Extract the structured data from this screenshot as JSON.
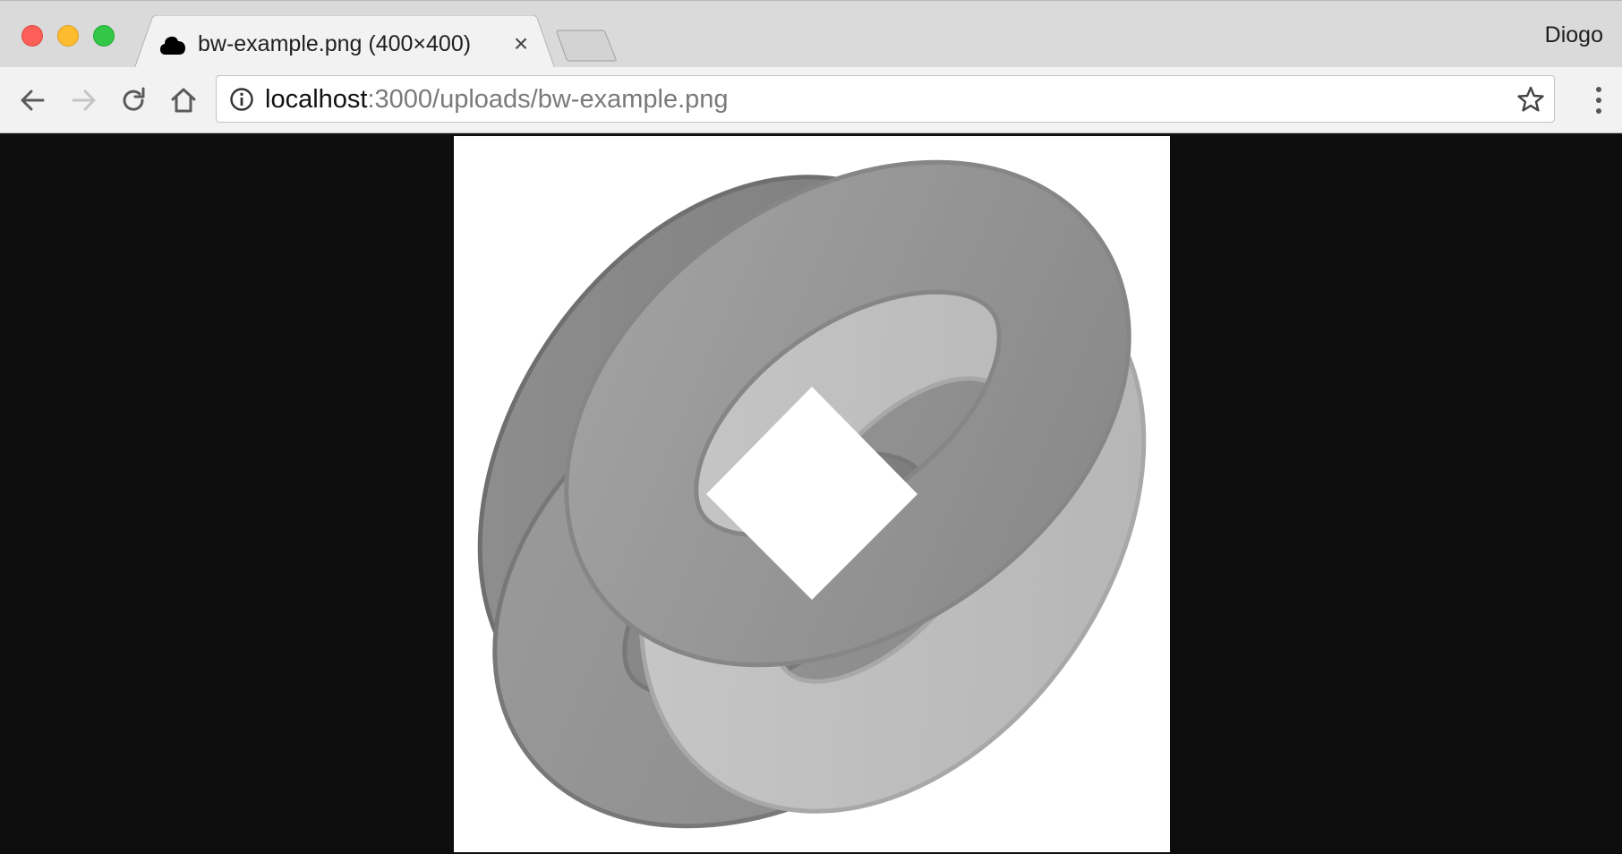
{
  "window": {
    "profile_name": "Diogo"
  },
  "tab": {
    "title": "bw-example.png (400×400)",
    "close_glyph": "×",
    "favicon": "cloud-icon"
  },
  "toolbar": {
    "back_icon": "arrow-left-icon",
    "forward_icon": "arrow-right-icon",
    "reload_icon": "reload-icon",
    "home_icon": "home-icon",
    "menu_icon": "kebab-menu-icon"
  },
  "omnibox": {
    "host": "localhost",
    "rest": ":3000/uploads/bw-example.png",
    "info_icon": "info-icon",
    "bookmark_icon": "star-icon"
  },
  "viewer": {
    "image_name": "bw-example.png",
    "image_description_icon": "knot-logo",
    "background_color": "#0e0e0e"
  },
  "colors": {
    "traffic_close": "#fc5f57",
    "traffic_minimize": "#fdbc2e",
    "traffic_maximize": "#33c748"
  }
}
